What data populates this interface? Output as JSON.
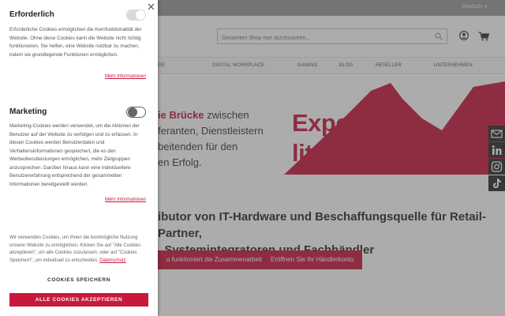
{
  "site": {
    "language": "Deutsch",
    "search_placeholder": "Gesamten Shop hier durchsuchen...",
    "nav": [
      "GE",
      "DIGITAL WORKPLACE",
      "GAMING",
      "BLOG",
      "RESELLER",
      "UNTERNEHMEN"
    ],
    "hero": {
      "line1_red": "ie Brücke",
      "line1_rest": " zwischen",
      "line2": "feranten, Dienstleistern",
      "line3": "beitenden für den",
      "line4": "en Erfolg.",
      "slogan_line1": "Expect a",
      "slogan_line2": "littlebit more..."
    },
    "intro_line1": "ibutor von IT-Hardware und Beschaffungsquelle für Retail-Partner,",
    "intro_line2": ", Systemintegratoren und Fachhändler",
    "button_how": "o funktioniert die Zusammenarbeit",
    "button_open": "Eröffnen Sie Ihr Händlerkonto",
    "colors": {
      "brand": "#c8193c",
      "overlay": "#464646"
    }
  },
  "consent": {
    "required": {
      "title": "Erforderlich",
      "description": "Erforderliche Cookies ermöglichen die Kernfunktionalität der Website. Ohne diese Cookies kann die Website nicht richtig funktionieren. Sie helfen, eine Website nutzbar zu machen, indem sie grundlegende Funktionen ermöglichen.",
      "more": "Mehr Informationen",
      "enabled": true
    },
    "marketing": {
      "title": "Marketing",
      "description": "Marketing-Cookies werden verwendet, um die Aktionen der Benutzer auf der Website zu verfolgen und zu erfassen. In diesen Cookies werden Benutzerdaten und Verhaltensinformationen gespeichert, die es den Werbedienstleistungen ermöglichen, mehr Zielgruppen anzusprechen. Darüber hinaus kann eine individuellere Benutzererfahrung entsprechend der gesammelten Informationen bereitgestellt werden.",
      "more": "Mehr Informationen",
      "enabled": false
    },
    "footer_text": "Wir verwenden Cookies, um Ihnen die bestmögliche Nutzung unserer Website zu ermöglichen. Klicken Sie auf \"Alle Cookies akzeptieren\", um alle Cookies zuzulassen, oder auf \"Cookies Speichern\", um individuell zu entscheiden. ",
    "privacy_link": "Datenschutz",
    "save_button": "COOKIES SPEICHERN",
    "accept_button": "ALLE COOKIES AKZEPTIEREN"
  }
}
